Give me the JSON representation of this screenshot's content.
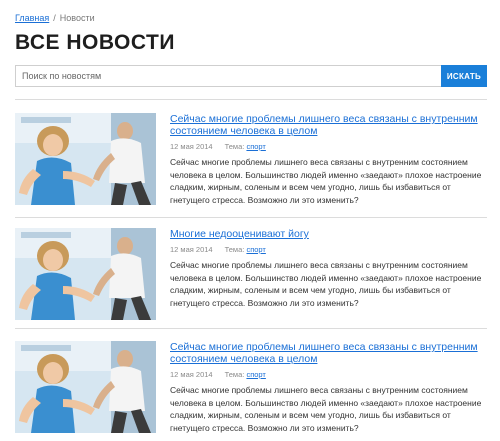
{
  "breadcrumb": {
    "home": "Главная",
    "separator": "/",
    "current": "Новости"
  },
  "page_title": "ВСЕ НОВОСТИ",
  "search": {
    "placeholder": "Поиск по новостям",
    "button": "ИСКАТЬ"
  },
  "news": [
    {
      "title": "Сейчас многие проблемы лишнего веса связаны с внутренним состоянием человека в целом",
      "date": "12 мая 2014",
      "topic_label": "Тема:",
      "topic": "спорт",
      "excerpt": "Сейчас многие проблемы лишнего веса связаны с внутренним состоянием человека в целом. Большинство людей именно «заедают» плохое настроение сладким, жирным, соленым и всем чем угодно, лишь бы избавиться от гнетущего стресса. Возможно ли это изменить?"
    },
    {
      "title": "Многие недооценивают йогу",
      "date": "12 мая 2014",
      "topic_label": "Тема:",
      "topic": "спорт",
      "excerpt": "Сейчас многие проблемы лишнего веса связаны с внутренним состоянием человека в целом. Большинство людей именно «заедают» плохое настроение сладким, жирным, соленым и всем чем угодно, лишь бы избавиться от гнетущего стресса. Возможно ли это изменить?"
    },
    {
      "title": "Сейчас многие проблемы лишнего веса связаны с внутренним состоянием человека в целом",
      "date": "12 мая 2014",
      "topic_label": "Тема:",
      "topic": "спорт",
      "excerpt": "Сейчас многие проблемы лишнего веса связаны с внутренним состоянием человека в целом. Большинство людей именно «заедают» плохое настроение сладким, жирным, соленым и всем чем угодно, лишь бы избавиться от гнетущего стресса. Возможно ли это изменить?"
    }
  ],
  "colors": {
    "link": "#1a6fd6",
    "accent": "#1a7fd9",
    "title": "#1e1e1e"
  }
}
